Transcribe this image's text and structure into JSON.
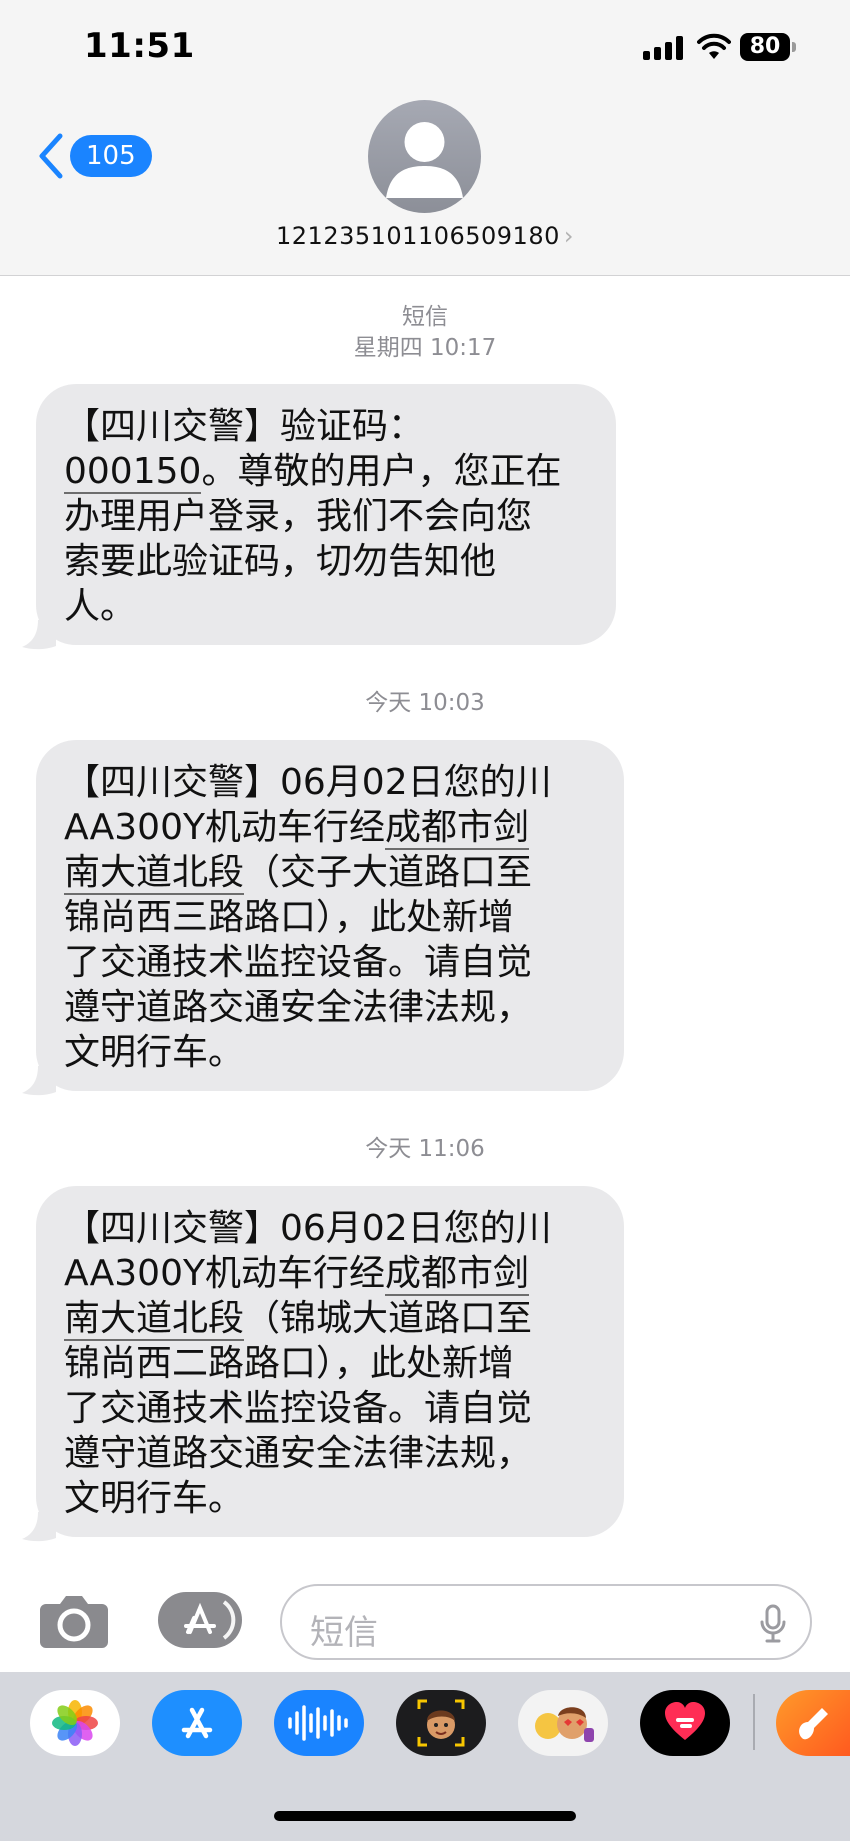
{
  "status_bar": {
    "time": "11:51",
    "battery": "80"
  },
  "header": {
    "back_count": "105",
    "contact": "12123510110650918​0"
  },
  "thread": {
    "service_label": "短信",
    "messages": [
      {
        "timestamp": "星期四 10:17",
        "lines": [
          "【四川交警】验证码：",
          "000150",
          "。尊敬的用户，您正在",
          "办理用户登录，我们不会向您",
          "索要此验证码，切勿告知他",
          "人。"
        ]
      },
      {
        "timestamp": "今天 10:03",
        "lines": [
          "【四川交警】06月02日您的川",
          "AA300Y机动车行经",
          "成都市剑",
          "南大道北段",
          "（交子大道路口至",
          "锦尚西三路路口），此处新增",
          "了交通技术监控设备。请自觉",
          "遵守道路交通安全法律法规，",
          "文明行车。"
        ]
      },
      {
        "timestamp": "今天 11:06",
        "lines": [
          "【四川交警】06月02日您的川",
          "AA300Y机动车行经",
          "成都市剑",
          "南大道北段",
          "（锦城大道路口至",
          "锦尚西二路路口），此处新增",
          "了交通技术监控设备。请自觉",
          "遵守道路交通安全法律法规，",
          "文明行车。"
        ]
      }
    ]
  },
  "input": {
    "placeholder": "短信"
  },
  "colors": {
    "accent": "#1a84ff",
    "bubble": "#e9e9eb",
    "header_bg": "#f5f5f5",
    "drawer_bg": "#d5d7dd"
  },
  "app_drawer": [
    "photos-icon",
    "app-store-icon",
    "audio-message-icon",
    "memoji-icon",
    "memoji-stickers-icon",
    "digital-touch-icon",
    "garageband-icon"
  ]
}
